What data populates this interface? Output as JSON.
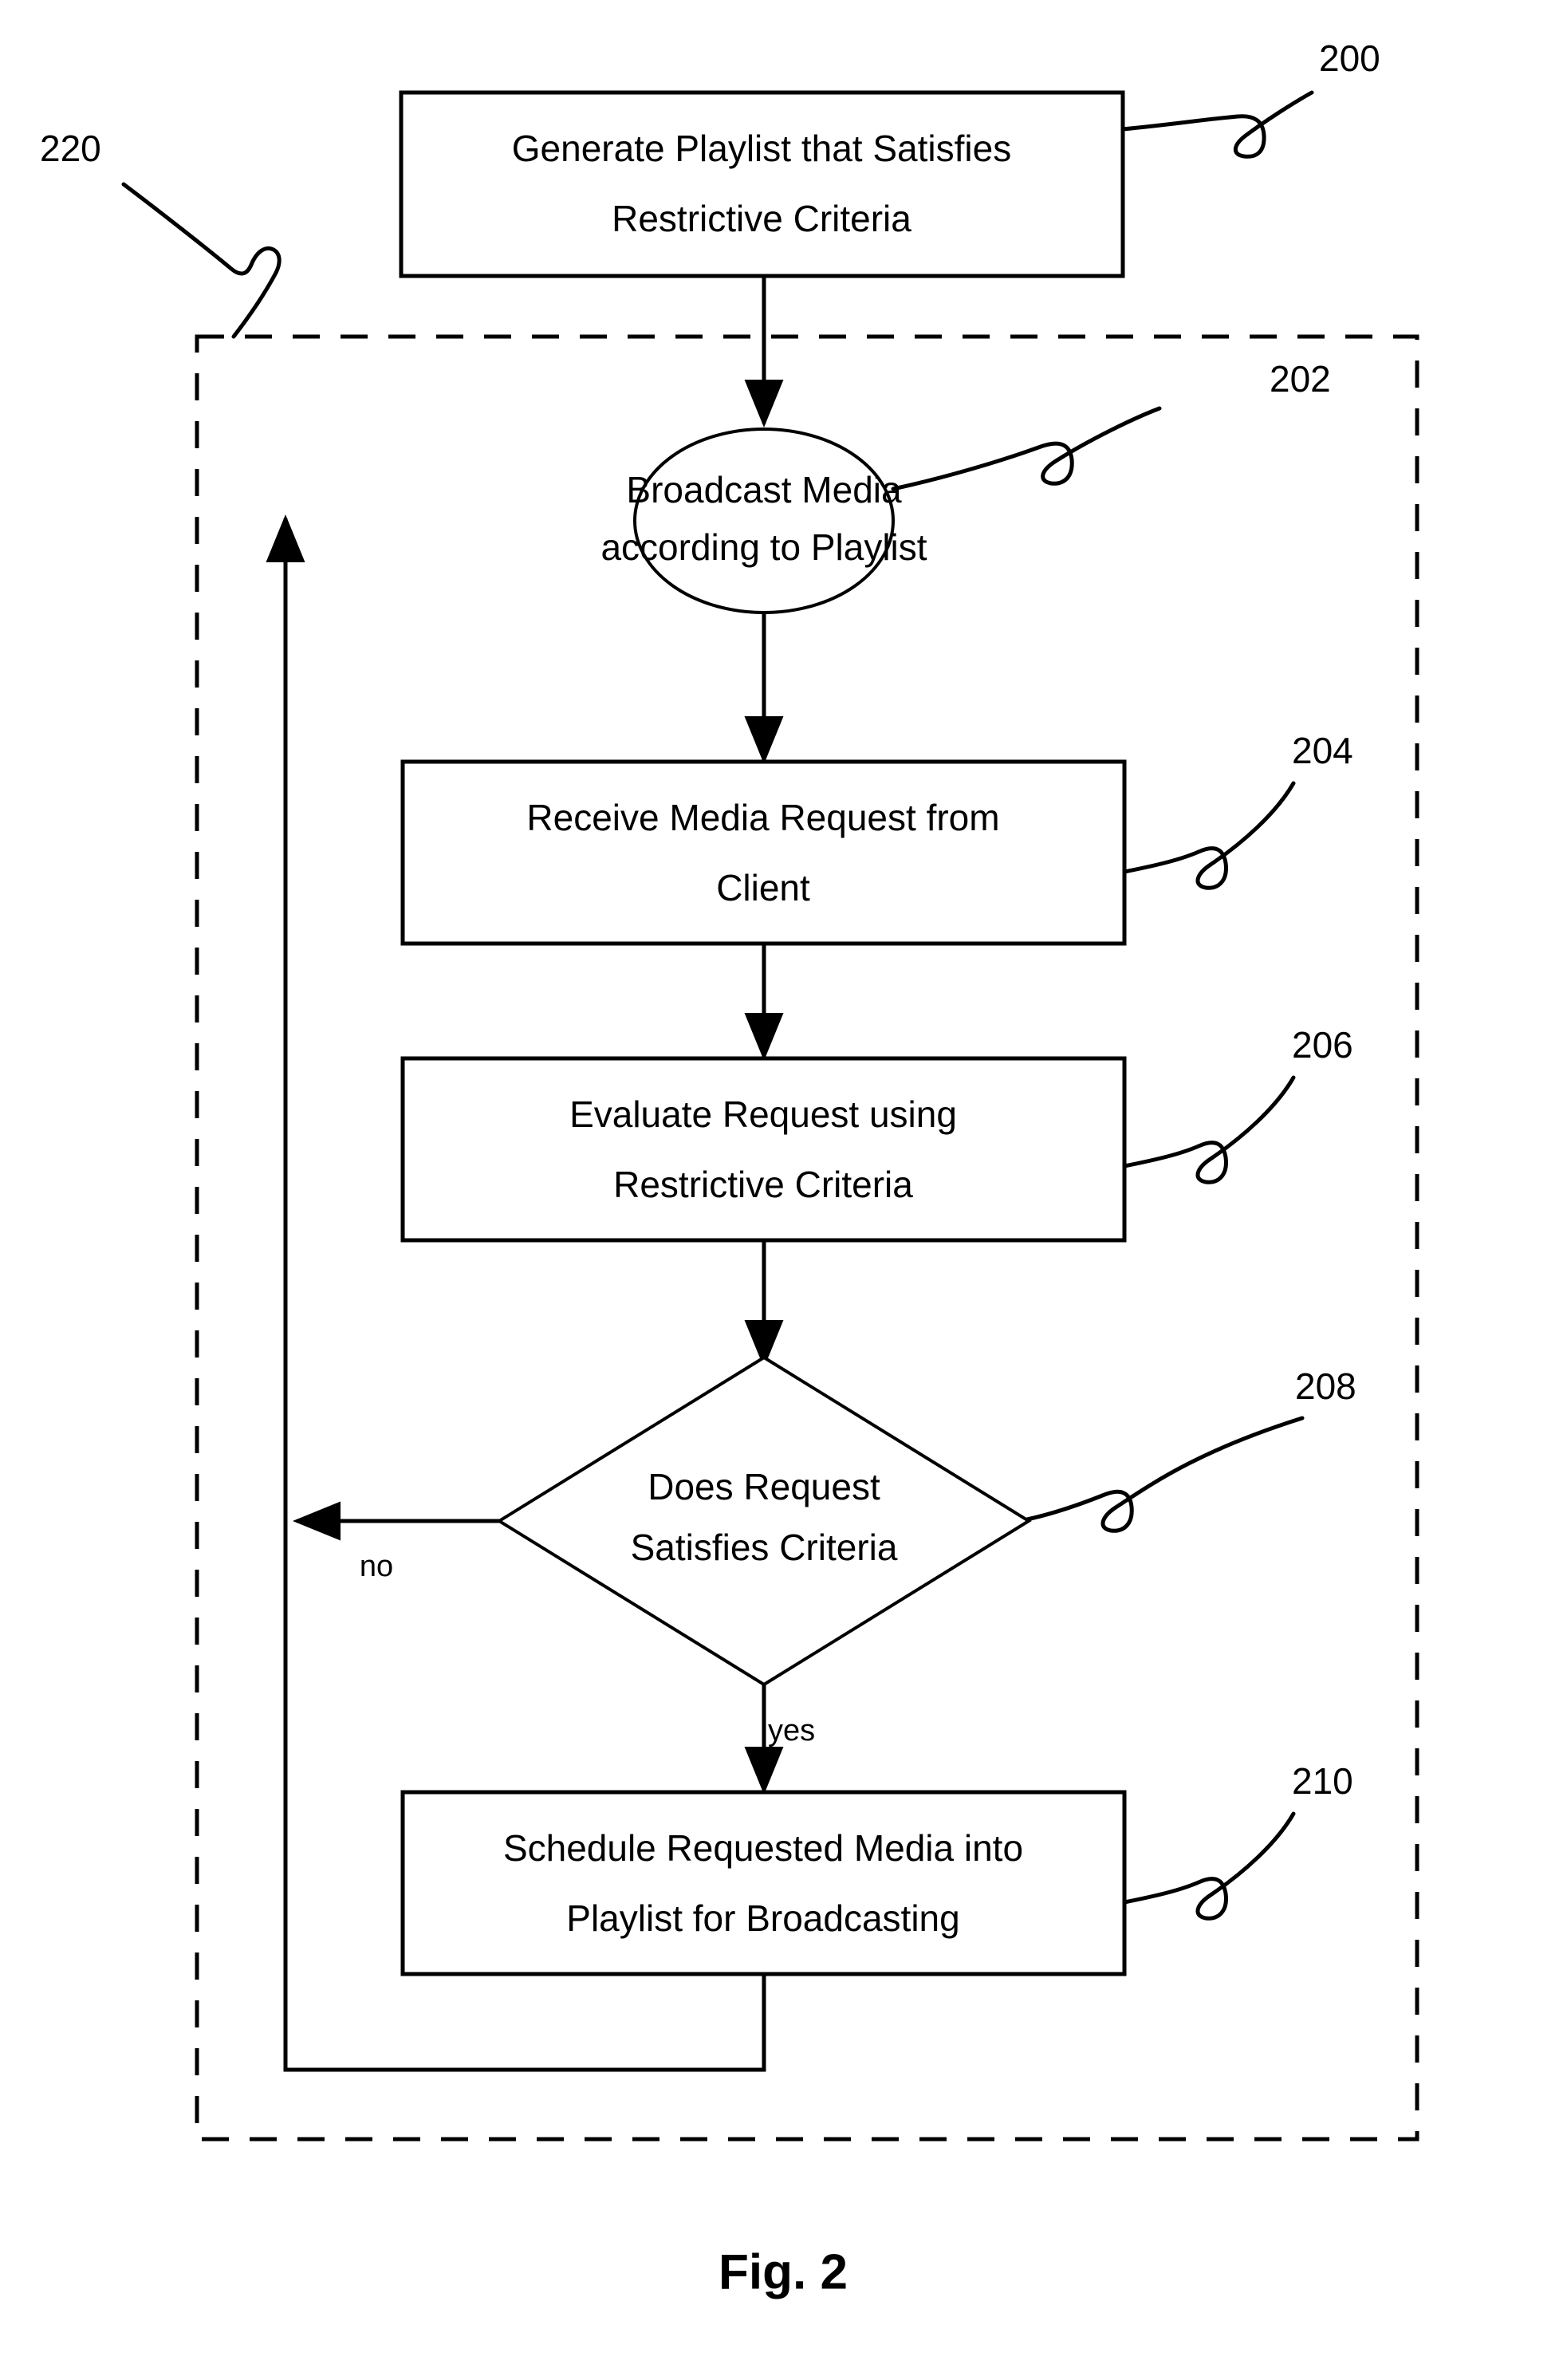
{
  "figure": {
    "caption": "Fig. 2",
    "background_color": "#ffffff",
    "line_color": "#000000"
  },
  "nodes": [
    {
      "id": "200",
      "shape": "rectangle",
      "ref": "200",
      "line1": "Generate Playlist that Satisfies",
      "line2": "Restrictive Criteria"
    },
    {
      "id": "202",
      "shape": "ellipse",
      "ref": "202",
      "line1": "Broadcast Media",
      "line2": "according to Playlist"
    },
    {
      "id": "204",
      "shape": "rectangle",
      "ref": "204",
      "line1": "Receive Media Request from",
      "line2": "Client"
    },
    {
      "id": "206",
      "shape": "rectangle",
      "ref": "206",
      "line1": "Evaluate Request using",
      "line2": "Restrictive Criteria"
    },
    {
      "id": "208",
      "shape": "diamond",
      "ref": "208",
      "line1": "Does Request",
      "line2": "Satisfies Criteria"
    },
    {
      "id": "210",
      "shape": "rectangle",
      "ref": "210",
      "line1": "Schedule Requested Media into",
      "line2": "Playlist for Broadcasting"
    }
  ],
  "region": {
    "id": "220",
    "ref": "220",
    "style": "dashed"
  },
  "edge_labels": {
    "no": "no",
    "yes": "yes"
  }
}
